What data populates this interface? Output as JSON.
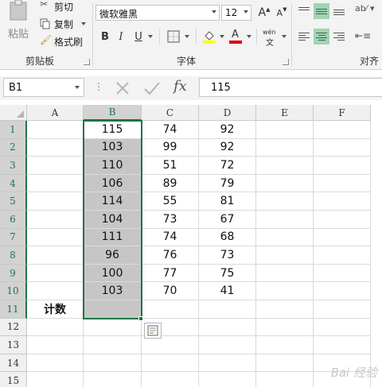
{
  "ribbon": {
    "clipboard": {
      "paste_label": "粘贴",
      "cut_label": "剪切",
      "copy_label": "复制",
      "format_painter_label": "格式刷",
      "group_label": "剪贴板"
    },
    "font": {
      "font_name": "微软雅黑",
      "font_size": "12",
      "grow_glyph": "A",
      "shrink_glyph": "A",
      "bold": "B",
      "italic": "I",
      "underline": "U",
      "wen_glyph": "wén",
      "wen_sub": "文",
      "group_label": "字体"
    },
    "alignment": {
      "group_label": "对齐方"
    }
  },
  "formula_bar": {
    "name_box": "B1",
    "value": "115",
    "fx_label": "fx"
  },
  "sheet": {
    "columns": [
      "A",
      "B",
      "C",
      "D",
      "E",
      "F"
    ],
    "rows": [
      "1",
      "2",
      "3",
      "4",
      "5",
      "6",
      "7",
      "8",
      "9",
      "10",
      "11",
      "12",
      "13",
      "14",
      "15"
    ],
    "selected_column": "B",
    "data": {
      "B": [
        "115",
        "103",
        "110",
        "106",
        "114",
        "104",
        "111",
        "96",
        "100",
        "103"
      ],
      "C": [
        "74",
        "99",
        "51",
        "89",
        "55",
        "73",
        "74",
        "76",
        "77",
        "70"
      ],
      "D": [
        "92",
        "92",
        "72",
        "79",
        "81",
        "67",
        "68",
        "73",
        "75",
        "41"
      ]
    },
    "a11_label": "计数"
  },
  "watermark": "Bai 经验",
  "colors": {
    "accent": "#217346",
    "selection_fill": "#c6c6c6",
    "active_align": "#9fd5b2"
  }
}
